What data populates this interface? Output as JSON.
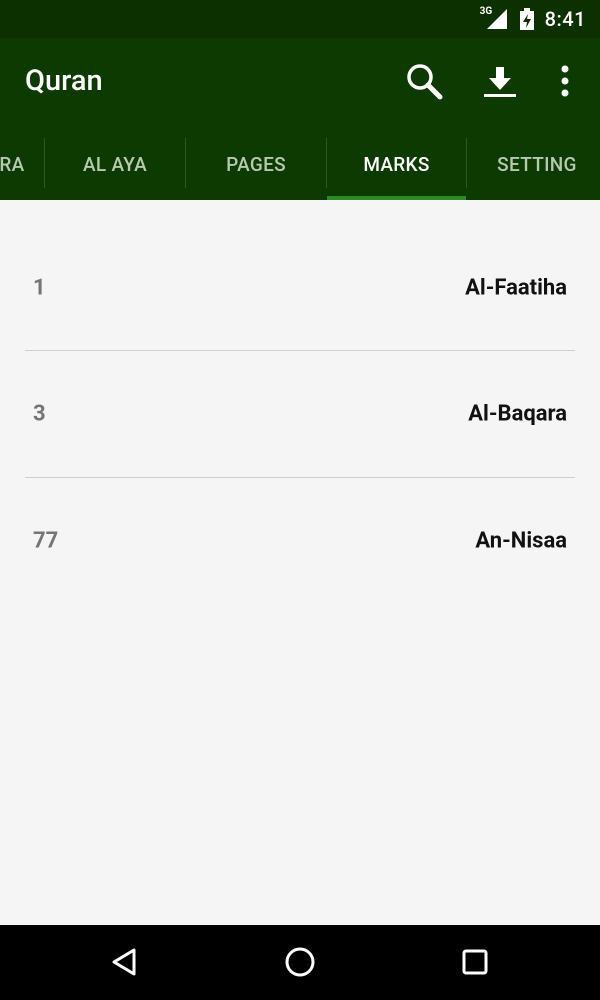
{
  "status_bar": {
    "time": "8:41",
    "network": "3G",
    "icons": [
      "signal-icon",
      "battery-icon"
    ]
  },
  "app_bar": {
    "title": "Quran",
    "actions": [
      "search-icon",
      "download-icon",
      "more-vert-icon"
    ]
  },
  "tabs": [
    {
      "label": "RA",
      "active": false
    },
    {
      "label": "AL AYA",
      "active": false
    },
    {
      "label": "PAGES",
      "active": false
    },
    {
      "label": "MARKS",
      "active": true
    },
    {
      "label": "SETTING",
      "active": false
    }
  ],
  "marks": [
    {
      "number": "1",
      "name": "Al-Faatiha"
    },
    {
      "number": "3",
      "name": "Al-Baqara"
    },
    {
      "number": "77",
      "name": "An-Nisaa"
    }
  ],
  "nav_bar": {
    "buttons": [
      "back-icon",
      "home-icon",
      "recents-icon"
    ]
  },
  "colors": {
    "primary": "#0d3a00",
    "status_bar": "#0c3000",
    "tab_indicator": "#2e8b24",
    "background": "#f5f5f5"
  }
}
